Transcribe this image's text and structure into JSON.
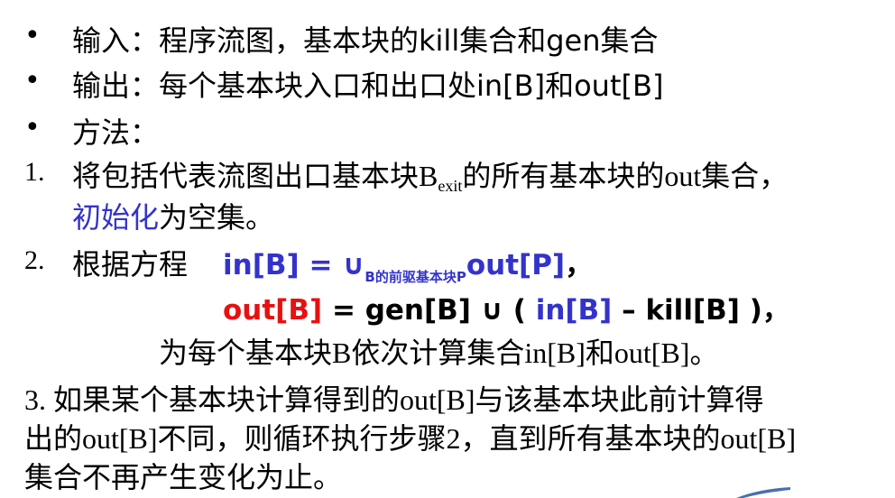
{
  "bullets": [
    {
      "marker": "•",
      "text": "输入：程序流图，基本块的kill集合和gen集合"
    },
    {
      "marker": "•",
      "text": "输出：每个基本块入口和出口处in[B]和out[B]"
    },
    {
      "marker": "•",
      "text": "方法："
    }
  ],
  "step1": {
    "num": "1.",
    "line1_pre": "将包括代表流图出口基本块B",
    "line1_sub": "exit",
    "line1_post": "的所有基本块的out集合，",
    "line2_blue": "初始化",
    "line2_rest": "为空集。"
  },
  "step2": {
    "num": "2.",
    "label": "根据方程",
    "eq1_lhs": "in[B]",
    "eq1_op": " = ∪",
    "eq1_sub": "B的前驱基本块P",
    "eq1_rhs": "out[P]",
    "eq1_end": "，",
    "eq2_lhs": "out[B]",
    "eq2_mid": " = gen[B] ∪ ( ",
    "eq2_in": "in[B]",
    "eq2_end": " – kill[B] )，",
    "note": "为每个基本块B依次计算集合in[B]和out[B]。"
  },
  "step3": {
    "line1": "3. 如果某个基本块计算得到的out[B]与该基本块此前计算得",
    "line2": "出的out[B]不同，则循环执行步骤2，直到所有基本块的out[B]",
    "line3": "集合不再产生变化为止。"
  },
  "colors": {
    "blue": "#3333cc",
    "red": "#e81010"
  }
}
